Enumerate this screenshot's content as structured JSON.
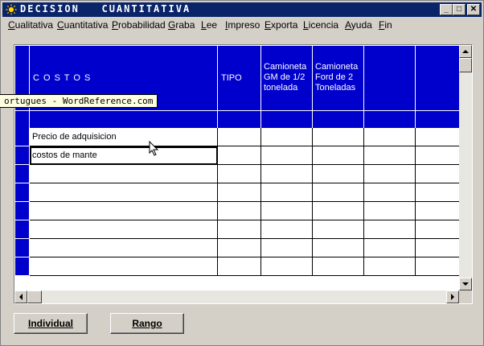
{
  "window": {
    "title": "DECISION   CUANTITATIVA",
    "minimize": "_",
    "maximize": "□",
    "close": "✕"
  },
  "menu": [
    {
      "label": "Cualitativa"
    },
    {
      "label": "Cuantitativa"
    },
    {
      "label": "Probabilidad"
    },
    {
      "label": "Graba"
    },
    {
      "label": "Lee"
    },
    {
      "label": "Impreso"
    },
    {
      "label": "Exporta"
    },
    {
      "label": "Licencia"
    },
    {
      "label": "Ayuda"
    },
    {
      "label": "Fin"
    }
  ],
  "grid": {
    "headers": {
      "costos": "C O S T O S",
      "tipo": "TIPO",
      "col1_line1": "Camioneta",
      "col1_line2": "GM de 1/2",
      "col1_line3": "tonelada",
      "col2_line1": "Camioneta",
      "col2_line2": "Ford de 2",
      "col2_line3": "Toneladas"
    },
    "rows": [
      {
        "costo": "Precio de adquisicion"
      },
      {
        "costo": "costos de mante"
      },
      {
        "costo": ""
      },
      {
        "costo": ""
      },
      {
        "costo": ""
      },
      {
        "costo": ""
      },
      {
        "costo": ""
      },
      {
        "costo": ""
      }
    ]
  },
  "tooltip": "ortugues - WordReference.com",
  "buttons": {
    "individual": "Individual",
    "rango": "Rango"
  },
  "colors": {
    "header_blue": "#0000cc",
    "titlebar": "#0a246a",
    "window_face": "#d4d0c8"
  },
  "icons": [
    "app-sun-icon",
    "minimize-icon",
    "maximize-icon",
    "close-icon",
    "scroll-up-icon",
    "scroll-down-icon",
    "scroll-left-icon",
    "scroll-right-icon",
    "mouse-cursor-icon"
  ]
}
